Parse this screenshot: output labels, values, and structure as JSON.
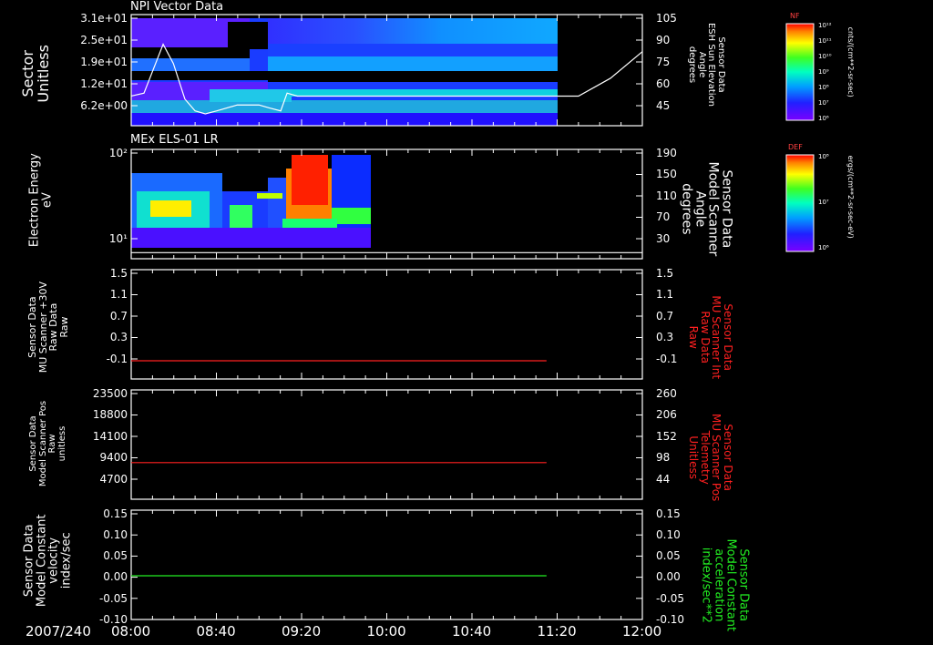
{
  "colors": {
    "axis": "#ffffff",
    "red": "#ff2020",
    "green": "#22ee22",
    "white": "#ffffff",
    "background": "#000000"
  },
  "time_axis": {
    "date": "2007/240",
    "ticks": [
      "08:00",
      "08:40",
      "09:20",
      "10:00",
      "10:40",
      "11:20",
      "12:00"
    ],
    "range_hours": [
      8.0,
      12.0
    ]
  },
  "panels": {
    "p1": {
      "title": "NPI Vector Data",
      "ylabel": [
        "Sector",
        "Unitless"
      ],
      "yticks": [
        "3.1e+01",
        "2.5e+01",
        "1.9e+01",
        "1.2e+01",
        "6.2e+00"
      ],
      "rticks": [
        "105",
        "90",
        "75",
        "60",
        "45"
      ],
      "rlabel": [
        "Sensor Data",
        "ESH Sun Elevation",
        "Angle",
        "degrees"
      ],
      "colorbar": {
        "label": "NF",
        "ticks": [
          "10¹²",
          "10¹¹",
          "10¹⁰",
          "10⁹",
          "10⁸",
          "10⁷",
          "10⁶"
        ],
        "unit": "cnts/(cm**2-sr-sec)"
      }
    },
    "p2": {
      "title": "MEx ELS-01 LR",
      "ylabel": [
        "Electron Energy",
        "eV"
      ],
      "yticks": [
        "10²",
        "10¹"
      ],
      "rticks": [
        "190",
        "150",
        "110",
        "70",
        "30"
      ],
      "rlabel": [
        "Sensor Data",
        "Model Scanner",
        "Angle",
        "degrees"
      ],
      "colorbar": {
        "label": "DEF",
        "ticks": [
          "10⁸",
          "10⁷",
          "10⁶"
        ],
        "unit": "ergs/(cm**2-sr-sec-eV)"
      }
    },
    "p3": {
      "ylabel": [
        "Sensor Data",
        "MU Scanner +30V",
        "Raw Data",
        "Raw"
      ],
      "yticks": [
        "1.5",
        "1.1",
        "0.7",
        "0.3",
        "-0.1"
      ],
      "rticks": [
        "1.5",
        "1.1",
        "0.7",
        "0.3",
        "-0.1"
      ],
      "rlabel": [
        "Sensor Data",
        "MU Scanner Int",
        "Raw Data",
        "Raw"
      ]
    },
    "p4": {
      "ylabel": [
        "Sensor Data",
        "Model Scanner Pos",
        "Raw",
        "unitless"
      ],
      "yticks": [
        "23500",
        "18800",
        "14100",
        "9400",
        "4700"
      ],
      "rticks": [
        "260",
        "206",
        "152",
        "98",
        "44"
      ],
      "rlabel": [
        "Sensor Data",
        "MU Scanner Pos",
        "Telemetry",
        "Unitless"
      ]
    },
    "p5": {
      "ylabel": [
        "Sensor Data",
        "Model Constant",
        "velocity",
        "index/sec"
      ],
      "yticks": [
        "0.15",
        "0.10",
        "0.05",
        "0.00",
        "-0.05",
        "-0.10"
      ],
      "rticks": [
        "0.15",
        "0.10",
        "0.05",
        "0.00",
        "-0.05",
        "-0.10"
      ],
      "rlabel": [
        "Sensor Data",
        "Model Constant",
        "acceleration",
        "index/sec**2"
      ]
    }
  },
  "chart_data": [
    {
      "type": "heatmap",
      "title": "NPI Vector Data",
      "x_range": [
        8.0,
        11.2
      ],
      "y_labels": [
        "3.1e+01",
        "2.5e+01",
        "1.9e+01",
        "1.2e+01",
        "6.2e+00"
      ],
      "overlay_line": {
        "name": "ESH Sun Elevation Angle",
        "ylim": [
          30,
          105
        ],
        "x": [
          8.0,
          8.1,
          8.25,
          8.33,
          8.42,
          8.5,
          8.58,
          8.67,
          8.83,
          9.0,
          9.08,
          9.17,
          9.22,
          9.3,
          9.5,
          10.0,
          11.0,
          11.5,
          11.75,
          12.0
        ],
        "y": [
          50,
          52,
          85,
          72,
          48,
          40,
          38,
          40,
          44,
          44,
          42,
          40,
          52,
          50,
          50,
          50,
          50,
          50,
          62,
          80
        ]
      }
    },
    {
      "type": "heatmap",
      "title": "MEx ELS-01 LR",
      "x_range": [
        8.0,
        9.85
      ],
      "ylim_log10": [
        0,
        2.2
      ],
      "overlay_line": {
        "name": "Model Scanner Angle",
        "ylim": [
          10,
          190
        ],
        "x": [
          8.0,
          12.0
        ],
        "y": [
          20,
          20
        ]
      }
    },
    {
      "type": "line",
      "series": [
        {
          "x": [
            8.0,
            11.25
          ],
          "y": [
            0.0,
            0.0
          ]
        }
      ],
      "ylim": [
        -0.3,
        1.5
      ]
    },
    {
      "type": "line",
      "series": [
        {
          "x": [
            8.0,
            11.25
          ],
          "y": [
            8000,
            8000
          ]
        }
      ],
      "ylim": [
        0,
        23500
      ]
    },
    {
      "type": "line",
      "series": [
        {
          "x": [
            8.0,
            11.25
          ],
          "y": [
            0.0,
            0.0
          ]
        }
      ],
      "ylim": [
        -0.1,
        0.15
      ]
    }
  ]
}
